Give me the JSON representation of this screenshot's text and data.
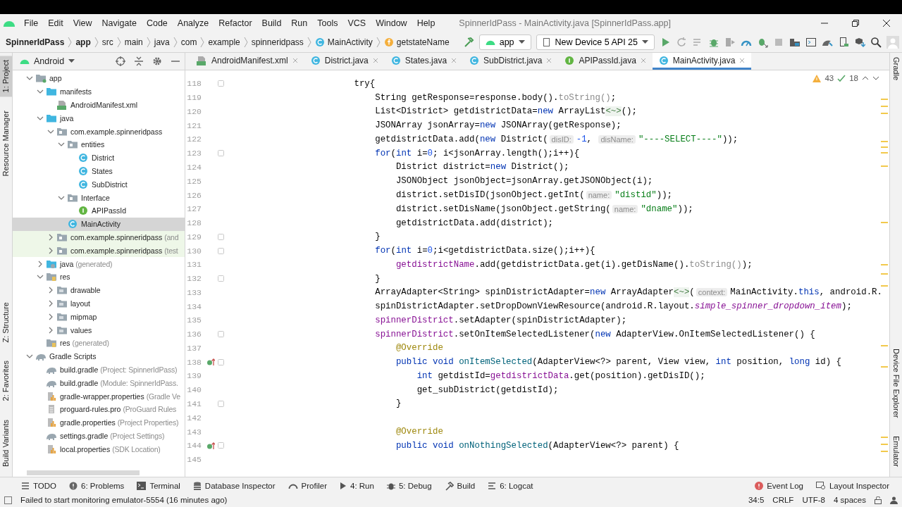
{
  "window": {
    "title": "SpinnerIdPass - MainActivity.java [SpinnerIdPass.app]"
  },
  "menu": [
    "File",
    "Edit",
    "View",
    "Navigate",
    "Code",
    "Analyze",
    "Refactor",
    "Build",
    "Run",
    "Tools",
    "VCS",
    "Window",
    "Help"
  ],
  "breadcrumb": [
    {
      "label": "SpinnerIdPass",
      "kind": "bold"
    },
    {
      "label": "app",
      "kind": "bold"
    },
    {
      "label": "src",
      "kind": "plain"
    },
    {
      "label": "main",
      "kind": "plain"
    },
    {
      "label": "java",
      "kind": "plain"
    },
    {
      "label": "com",
      "kind": "plain"
    },
    {
      "label": "example",
      "kind": "plain"
    },
    {
      "label": "spinneridpass",
      "kind": "plain"
    },
    {
      "label": "MainActivity",
      "kind": "class"
    },
    {
      "label": "getstateName",
      "kind": "field"
    }
  ],
  "toolbar": {
    "config": "app",
    "device": "New Device 5 API 25"
  },
  "left_strip": {
    "top": [
      {
        "label": "1: Project",
        "selected": true
      },
      {
        "label": "Resource Manager",
        "selected": false
      }
    ],
    "bottom": [
      {
        "label": "Z: Structure",
        "selected": false
      },
      {
        "label": "2: Favorites",
        "selected": false
      },
      {
        "label": "Build Variants",
        "selected": false
      }
    ]
  },
  "right_strip": {
    "top": [
      "Gradle"
    ],
    "bottom": [
      "Device File Explorer",
      "Emulator"
    ]
  },
  "project": {
    "view": "Android",
    "tree": [
      {
        "label": "app",
        "kind": "module",
        "expanded": true,
        "selected": false,
        "children": [
          {
            "label": "manifests",
            "kind": "srcfolder",
            "expanded": true,
            "selected": false,
            "children": [
              {
                "label": "AndroidManifest.xml",
                "kind": "manifest",
                "selected": false
              }
            ]
          },
          {
            "label": "java",
            "kind": "srcfolder",
            "expanded": true,
            "selected": false,
            "children": [
              {
                "label": "com.example.spinneridpass",
                "kind": "package",
                "expanded": true,
                "selected": false,
                "children": [
                  {
                    "label": "entities",
                    "kind": "package",
                    "expanded": true,
                    "selected": false,
                    "children": [
                      {
                        "label": "District",
                        "kind": "class",
                        "selected": false
                      },
                      {
                        "label": "States",
                        "kind": "class",
                        "selected": false
                      },
                      {
                        "label": "SubDistrict",
                        "kind": "class",
                        "selected": false
                      }
                    ]
                  },
                  {
                    "label": "Interface",
                    "kind": "package",
                    "expanded": true,
                    "selected": false,
                    "children": [
                      {
                        "label": "APIPassId",
                        "kind": "interface",
                        "selected": false
                      }
                    ]
                  },
                  {
                    "label": "MainActivity",
                    "kind": "class",
                    "selected": true
                  }
                ]
              },
              {
                "label": "com.example.spinneridpass",
                "note": "(and",
                "kind": "package",
                "expanded": false,
                "selected": false,
                "test_source": true
              },
              {
                "label": "com.example.spinneridpass",
                "note": "(test",
                "kind": "package",
                "expanded": false,
                "selected": false,
                "test_source": true
              }
            ]
          },
          {
            "label": "java",
            "note": "(generated)",
            "kind": "genfolder",
            "expanded": false,
            "selected": false
          },
          {
            "label": "res",
            "kind": "resfolder",
            "expanded": true,
            "selected": false,
            "children": [
              {
                "label": "drawable",
                "kind": "dir",
                "expanded": false,
                "selected": false
              },
              {
                "label": "layout",
                "kind": "dir",
                "expanded": false,
                "selected": false
              },
              {
                "label": "mipmap",
                "kind": "dir",
                "expanded": false,
                "selected": false
              },
              {
                "label": "values",
                "kind": "dir",
                "expanded": false,
                "selected": false
              }
            ]
          },
          {
            "label": "res",
            "note": "(generated)",
            "kind": "resfolder",
            "selected": false
          }
        ]
      },
      {
        "label": "Gradle Scripts",
        "kind": "gradle",
        "expanded": true,
        "selected": false,
        "children": [
          {
            "label": "build.gradle",
            "note": "(Project: SpinnerIdPass)",
            "kind": "gradle",
            "selected": false
          },
          {
            "label": "build.gradle",
            "note": "(Module: SpinnerIdPass.",
            "kind": "gradle",
            "selected": false
          },
          {
            "label": "gradle-wrapper.properties",
            "note": "(Gradle Ve",
            "kind": "props",
            "selected": false
          },
          {
            "label": "proguard-rules.pro",
            "note": "(ProGuard Rules",
            "kind": "text",
            "selected": false
          },
          {
            "label": "gradle.properties",
            "note": "(Project Properties)",
            "kind": "props",
            "selected": false
          },
          {
            "label": "settings.gradle",
            "note": "(Project Settings)",
            "kind": "gradle",
            "selected": false
          },
          {
            "label": "local.properties",
            "note": "(SDK Location)",
            "kind": "props",
            "selected": false
          }
        ]
      }
    ]
  },
  "tabs": [
    {
      "label": "AndroidManifest.xml",
      "kind": "manifest",
      "selected": false
    },
    {
      "label": "District.java",
      "kind": "class",
      "selected": false
    },
    {
      "label": "States.java",
      "kind": "class",
      "selected": false
    },
    {
      "label": "SubDistrict.java",
      "kind": "class",
      "selected": false
    },
    {
      "label": "APIPassId.java",
      "kind": "interface",
      "selected": false
    },
    {
      "label": "MainActivity.java",
      "kind": "class",
      "selected": true
    }
  ],
  "inspections": {
    "warnings": "43",
    "weak_warnings": "18"
  },
  "code": [
    {
      "number": "118",
      "fold": true,
      "override": false,
      "tokens": [
        {
          "kind": "plain",
          "text": "                        try{"
        }
      ]
    },
    {
      "number": "119",
      "fold": false,
      "override": false,
      "tokens": [
        {
          "kind": "plain",
          "text": "                            String getResponse=response.body()."
        },
        {
          "kind": "muted",
          "text": "toString()"
        },
        {
          "kind": "plain",
          "text": ";"
        }
      ]
    },
    {
      "number": "120",
      "fold": false,
      "override": false,
      "tokens": [
        {
          "kind": "plain",
          "text": "                            List<District> getdistrictData="
        },
        {
          "kind": "kw",
          "text": "new"
        },
        {
          "kind": "plain",
          "text": " ArrayList"
        },
        {
          "kind": "folded",
          "text": "<~>"
        },
        {
          "kind": "plain",
          "text": "();"
        }
      ]
    },
    {
      "number": "121",
      "fold": false,
      "override": false,
      "tokens": [
        {
          "kind": "plain",
          "text": "                            JSONArray jsonArray="
        },
        {
          "kind": "kw",
          "text": "new"
        },
        {
          "kind": "plain",
          "text": " JSONArray(getResponse);"
        }
      ]
    },
    {
      "number": "122",
      "fold": false,
      "override": false,
      "tokens": [
        {
          "kind": "plain",
          "text": "                            getdistrictData.add("
        },
        {
          "kind": "kw",
          "text": "new"
        },
        {
          "kind": "plain",
          "text": " District("
        },
        {
          "kind": "hint",
          "text": "disID:"
        },
        {
          "kind": "num",
          "text": "-1"
        },
        {
          "kind": "plain",
          "text": ", "
        },
        {
          "kind": "hint",
          "text": "disName:"
        },
        {
          "kind": "str",
          "text": "\"----SELECT----\""
        },
        {
          "kind": "plain",
          "text": "));"
        }
      ]
    },
    {
      "number": "123",
      "fold": true,
      "override": false,
      "tokens": [
        {
          "kind": "kw",
          "text": "                            for"
        },
        {
          "kind": "plain",
          "text": "("
        },
        {
          "kind": "kw",
          "text": "int"
        },
        {
          "kind": "plain",
          "text": " i="
        },
        {
          "kind": "num",
          "text": "0"
        },
        {
          "kind": "plain",
          "text": "; i<jsonArray.length();i++){"
        }
      ]
    },
    {
      "number": "124",
      "fold": false,
      "override": false,
      "tokens": [
        {
          "kind": "plain",
          "text": "                                District district="
        },
        {
          "kind": "kw",
          "text": "new"
        },
        {
          "kind": "plain",
          "text": " District();"
        }
      ]
    },
    {
      "number": "125",
      "fold": false,
      "override": false,
      "tokens": [
        {
          "kind": "plain",
          "text": "                                JSONObject jsonObject=jsonArray.getJSONObject(i);"
        }
      ]
    },
    {
      "number": "126",
      "fold": false,
      "override": false,
      "tokens": [
        {
          "kind": "plain",
          "text": "                                district.setDisID(jsonObject.getInt("
        },
        {
          "kind": "hint",
          "text": "name:"
        },
        {
          "kind": "str",
          "text": "\"distid\""
        },
        {
          "kind": "plain",
          "text": "));"
        }
      ]
    },
    {
      "number": "127",
      "fold": false,
      "override": false,
      "tokens": [
        {
          "kind": "plain",
          "text": "                                district.setDisName(jsonObject.getString("
        },
        {
          "kind": "hint",
          "text": "name:"
        },
        {
          "kind": "str",
          "text": "\"dname\""
        },
        {
          "kind": "plain",
          "text": "));"
        }
      ]
    },
    {
      "number": "128",
      "fold": false,
      "override": false,
      "tokens": [
        {
          "kind": "plain",
          "text": "                                getdistrictData.add(district);"
        }
      ]
    },
    {
      "number": "129",
      "fold": true,
      "override": false,
      "tokens": [
        {
          "kind": "plain",
          "text": "                            }"
        }
      ]
    },
    {
      "number": "130",
      "fold": true,
      "override": false,
      "tokens": [
        {
          "kind": "kw",
          "text": "                            for"
        },
        {
          "kind": "plain",
          "text": "("
        },
        {
          "kind": "kw",
          "text": "int"
        },
        {
          "kind": "plain",
          "text": " i="
        },
        {
          "kind": "num",
          "text": "0"
        },
        {
          "kind": "plain",
          "text": ";i<getdistrictData.size();i++){"
        }
      ]
    },
    {
      "number": "131",
      "fold": false,
      "override": false,
      "tokens": [
        {
          "kind": "field",
          "text": "                                getdistrictName"
        },
        {
          "kind": "plain",
          "text": ".add(getdistrictData.get(i).getDisName()."
        },
        {
          "kind": "muted",
          "text": "toString()"
        },
        {
          "kind": "plain",
          "text": ");"
        }
      ]
    },
    {
      "number": "132",
      "fold": true,
      "override": false,
      "tokens": [
        {
          "kind": "plain",
          "text": "                            }"
        }
      ]
    },
    {
      "number": "133",
      "fold": false,
      "override": false,
      "tokens": [
        {
          "kind": "plain",
          "text": "                            ArrayAdapter<String> spinDistrictAdapter="
        },
        {
          "kind": "kw",
          "text": "new"
        },
        {
          "kind": "plain",
          "text": " ArrayAdapter"
        },
        {
          "kind": "folded",
          "text": "<~>"
        },
        {
          "kind": "plain",
          "text": "("
        },
        {
          "kind": "hint",
          "text": "context:"
        },
        {
          "kind": "plain",
          "text": "MainActivity."
        },
        {
          "kind": "kw",
          "text": "this"
        },
        {
          "kind": "plain",
          "text": ", android.R."
        }
      ]
    },
    {
      "number": "134",
      "fold": false,
      "override": false,
      "tokens": [
        {
          "kind": "plain",
          "text": "                            spinDistrictAdapter.setDropDownViewResource(android.R.layout."
        },
        {
          "kind": "ifield",
          "text": "simple_spinner_dropdown_item"
        },
        {
          "kind": "plain",
          "text": ");"
        }
      ]
    },
    {
      "number": "135",
      "fold": false,
      "override": false,
      "tokens": [
        {
          "kind": "field",
          "text": "                            spinnerDistrict"
        },
        {
          "kind": "plain",
          "text": ".setAdapter(spinDistrictAdapter);"
        }
      ]
    },
    {
      "number": "136",
      "fold": true,
      "override": false,
      "tokens": [
        {
          "kind": "field",
          "text": "                            spinnerDistrict"
        },
        {
          "kind": "plain",
          "text": ".setOnItemSelectedListener("
        },
        {
          "kind": "kw",
          "text": "new"
        },
        {
          "kind": "plain",
          "text": " AdapterView.OnItemSelectedListener() {"
        }
      ]
    },
    {
      "number": "137",
      "fold": false,
      "override": false,
      "tokens": [
        {
          "kind": "ann",
          "text": "                                @Override"
        }
      ]
    },
    {
      "number": "138",
      "fold": true,
      "override": true,
      "tokens": [
        {
          "kind": "kw",
          "text": "                                public void "
        },
        {
          "kind": "method",
          "text": "onItemSelected"
        },
        {
          "kind": "plain",
          "text": "(AdapterView<?> parent, View view, "
        },
        {
          "kind": "kw",
          "text": "int"
        },
        {
          "kind": "plain",
          "text": " position, "
        },
        {
          "kind": "kw",
          "text": "long"
        },
        {
          "kind": "plain",
          "text": " id) {"
        }
      ]
    },
    {
      "number": "139",
      "fold": false,
      "override": false,
      "tokens": [
        {
          "kind": "kw",
          "text": "                                    int"
        },
        {
          "kind": "plain",
          "text": " getdistId="
        },
        {
          "kind": "field",
          "text": "getdistrictData"
        },
        {
          "kind": "plain",
          "text": ".get(position).getDisID();"
        }
      ]
    },
    {
      "number": "140",
      "fold": false,
      "override": false,
      "tokens": [
        {
          "kind": "plain",
          "text": "                                    get_subDistrict(getdistId);"
        }
      ]
    },
    {
      "number": "141",
      "fold": true,
      "override": false,
      "tokens": [
        {
          "kind": "plain",
          "text": "                                }"
        }
      ]
    },
    {
      "number": "142",
      "fold": false,
      "override": false
    },
    {
      "number": "143",
      "fold": false,
      "override": false,
      "tokens": [
        {
          "kind": "ann",
          "text": "                                @Override"
        }
      ]
    },
    {
      "number": "144",
      "fold": true,
      "override": true,
      "tokens": [
        {
          "kind": "kw",
          "text": "                                public void "
        },
        {
          "kind": "method",
          "text": "onNothingSelected"
        },
        {
          "kind": "plain",
          "text": "(AdapterView<?> parent) {"
        }
      ]
    },
    {
      "number": "145",
      "fold": false,
      "override": false
    }
  ],
  "bottom_tools": {
    "left": [
      {
        "label": "TODO",
        "kind": "todo"
      },
      {
        "label": "6: Problems",
        "kind": "problems"
      },
      {
        "label": "Terminal",
        "kind": "terminal"
      },
      {
        "label": "Database Inspector",
        "kind": "database"
      },
      {
        "label": "Profiler",
        "kind": "profiler"
      },
      {
        "label": "4: Run",
        "kind": "run"
      },
      {
        "label": "5: Debug",
        "kind": "debug"
      },
      {
        "label": "Build",
        "kind": "build"
      },
      {
        "label": "6: Logcat",
        "kind": "logcat"
      }
    ],
    "right": [
      {
        "label": "Event Log",
        "kind": "eventlog"
      },
      {
        "label": "Layout Inspector",
        "kind": "layout"
      }
    ]
  },
  "status": {
    "message": "Failed to start monitoring emulator-5554 (16 minutes ago)",
    "position": "34:5",
    "line_separator": "CRLF",
    "encoding": "UTF-8",
    "indent": "4 spaces"
  }
}
